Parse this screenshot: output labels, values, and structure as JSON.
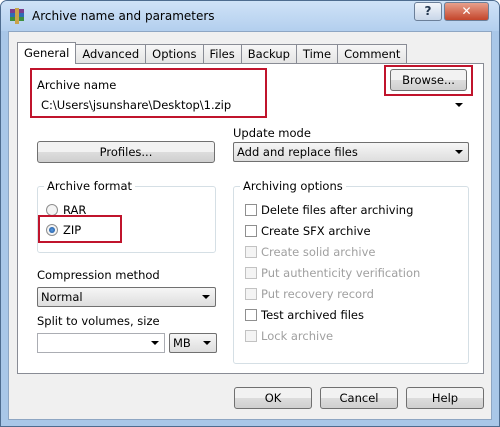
{
  "window": {
    "title": "Archive name and parameters",
    "help_glyph": "?",
    "close_glyph": "✕"
  },
  "tabs": [
    {
      "label": "General",
      "active": true
    },
    {
      "label": "Advanced"
    },
    {
      "label": "Options"
    },
    {
      "label": "Files"
    },
    {
      "label": "Backup"
    },
    {
      "label": "Time"
    },
    {
      "label": "Comment"
    }
  ],
  "archive_name": {
    "label": "Archive name",
    "value": "C:\\Users\\jsunshare\\Desktop\\1.zip",
    "browse_label": "Browse..."
  },
  "profiles_label": "Profiles...",
  "update_mode": {
    "label": "Update mode",
    "value": "Add and replace files"
  },
  "archive_format": {
    "label": "Archive format",
    "options": [
      {
        "label": "RAR",
        "checked": false
      },
      {
        "label": "ZIP",
        "checked": true
      }
    ]
  },
  "compression": {
    "label": "Compression method",
    "value": "Normal"
  },
  "split": {
    "label": "Split to volumes, size",
    "value": "",
    "unit": "MB"
  },
  "archiving_options": {
    "label": "Archiving options",
    "items": [
      {
        "label": "Delete files after archiving",
        "enabled": true,
        "checked": false
      },
      {
        "label": "Create SFX archive",
        "enabled": true,
        "checked": false
      },
      {
        "label": "Create solid archive",
        "enabled": false,
        "checked": false
      },
      {
        "label": "Put authenticity verification",
        "enabled": false,
        "checked": false
      },
      {
        "label": "Put recovery record",
        "enabled": false,
        "checked": false
      },
      {
        "label": "Test archived files",
        "enabled": true,
        "checked": false
      },
      {
        "label": "Lock archive",
        "enabled": false,
        "checked": false
      }
    ]
  },
  "buttons": {
    "ok": "OK",
    "cancel": "Cancel",
    "help": "Help"
  },
  "colors": {
    "highlight": "#c0142c",
    "title_bar": "#b3cfee",
    "radio_dot": "#154f98"
  }
}
